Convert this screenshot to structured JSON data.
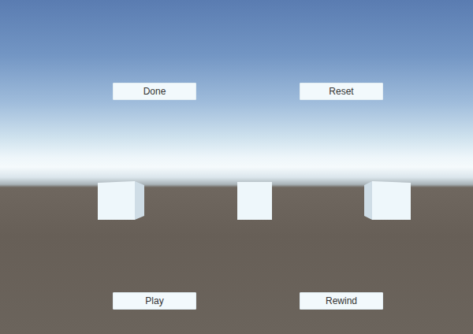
{
  "buttons": [
    {
      "label": "Done"
    },
    {
      "label": "Reset"
    },
    {
      "label": "Play"
    },
    {
      "label": "Rewind"
    }
  ]
}
